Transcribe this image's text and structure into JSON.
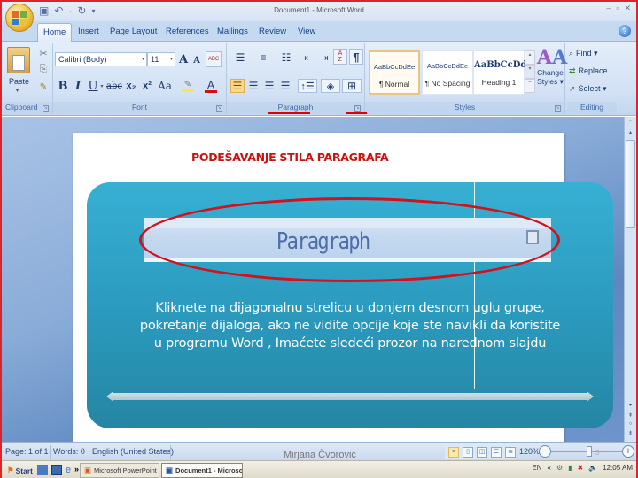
{
  "window": {
    "title": "Document1 - Microsoft Word",
    "controls": [
      "minimize",
      "maximize",
      "close"
    ]
  },
  "quick_access": {
    "items": [
      {
        "name": "save-icon",
        "glyph": "💾"
      },
      {
        "name": "undo-icon",
        "glyph": "↶"
      },
      {
        "name": "redo-icon",
        "glyph": "↻"
      },
      {
        "name": "customize-icon",
        "glyph": "▾"
      }
    ]
  },
  "tabs": [
    {
      "label": "Home",
      "active": true
    },
    {
      "label": "Insert"
    },
    {
      "label": "Page Layout"
    },
    {
      "label": "References"
    },
    {
      "label": "Mailings"
    },
    {
      "label": "Review"
    },
    {
      "label": "View"
    }
  ],
  "ribbon": {
    "clipboard": {
      "label": "Clipboard",
      "paste_label": "Paste",
      "cut_icon": "✂",
      "copy_icon": "⎘",
      "format_painter_icon": "🖌"
    },
    "font": {
      "label": "Font",
      "font_name": "Calibri (Body)",
      "font_size": "11",
      "grow_label": "A",
      "shrink_label": "A",
      "clear_label": "ABC",
      "bold": "B",
      "italic": "I",
      "underline": "U",
      "strike": "abc",
      "subscript": "x₂",
      "superscript": "x²",
      "change_case": "Aa",
      "highlight_color": "#f5e84a",
      "font_color": "#d01010"
    },
    "paragraph": {
      "label": "Paragraph",
      "bullets": "☰",
      "numbering": "≡",
      "multilevel": "☷",
      "decrease_indent": "⇤",
      "increase_indent": "⇥",
      "sort": "A↓Z",
      "show_marks": "¶",
      "align_left": "☰",
      "center": "☰",
      "align_right": "☰",
      "justify": "☰",
      "line_spacing": "↕",
      "shading": "◈",
      "borders": "⊞"
    },
    "styles": {
      "label": "Styles",
      "items": [
        {
          "sample": "AaBbCcDdEe",
          "name": "¶ Normal",
          "selected": true
        },
        {
          "sample": "AaBbCcDdEe",
          "name": "¶ No Spacing"
        },
        {
          "sample": "AaBbCcDd",
          "name": "Heading 1"
        }
      ],
      "change_styles_line1": "Change",
      "change_styles_line2": "Styles ▾"
    },
    "editing": {
      "label": "Editing",
      "find": "Find ▾",
      "replace": "Replace",
      "select": "Select ▾"
    }
  },
  "document": {
    "heading": "PODEŠAVANJE STILA PARAGRAFA",
    "slide": {
      "zoomed_group_label": "Paragraph",
      "body_lines": [
        "Kliknete na dijagonalnu strelicu u donjem desnom uglu grupe,",
        "pokretanje dijaloga, ako ne vidite opcije koje ste navikli da koristite",
        "u programu Word , Imaćete  sledeći prozor na narednom slajdu"
      ]
    },
    "author": "Mirjana Čvorović"
  },
  "statusbar": {
    "page": "Page: 1 of 1",
    "words": "Words: 0",
    "language": "English (United States)",
    "zoom": "120%",
    "zoom_level_percent": 120,
    "slide_number": "3"
  },
  "taskbar": {
    "start": "Start",
    "overflow": "»",
    "tasks": [
      {
        "label": "Microsoft PowerPoint - [...",
        "active": false
      },
      {
        "label": "Document1 - Microso...",
        "active": true
      }
    ],
    "language": "EN",
    "tray_expand": "«",
    "clock": "12:05 AM"
  },
  "colors": {
    "annotation_red": "#d4101c",
    "heading_red": "#cc1111",
    "slide_teal": "#2b9bbf",
    "ribbon_blue": "#c5d9f1"
  }
}
